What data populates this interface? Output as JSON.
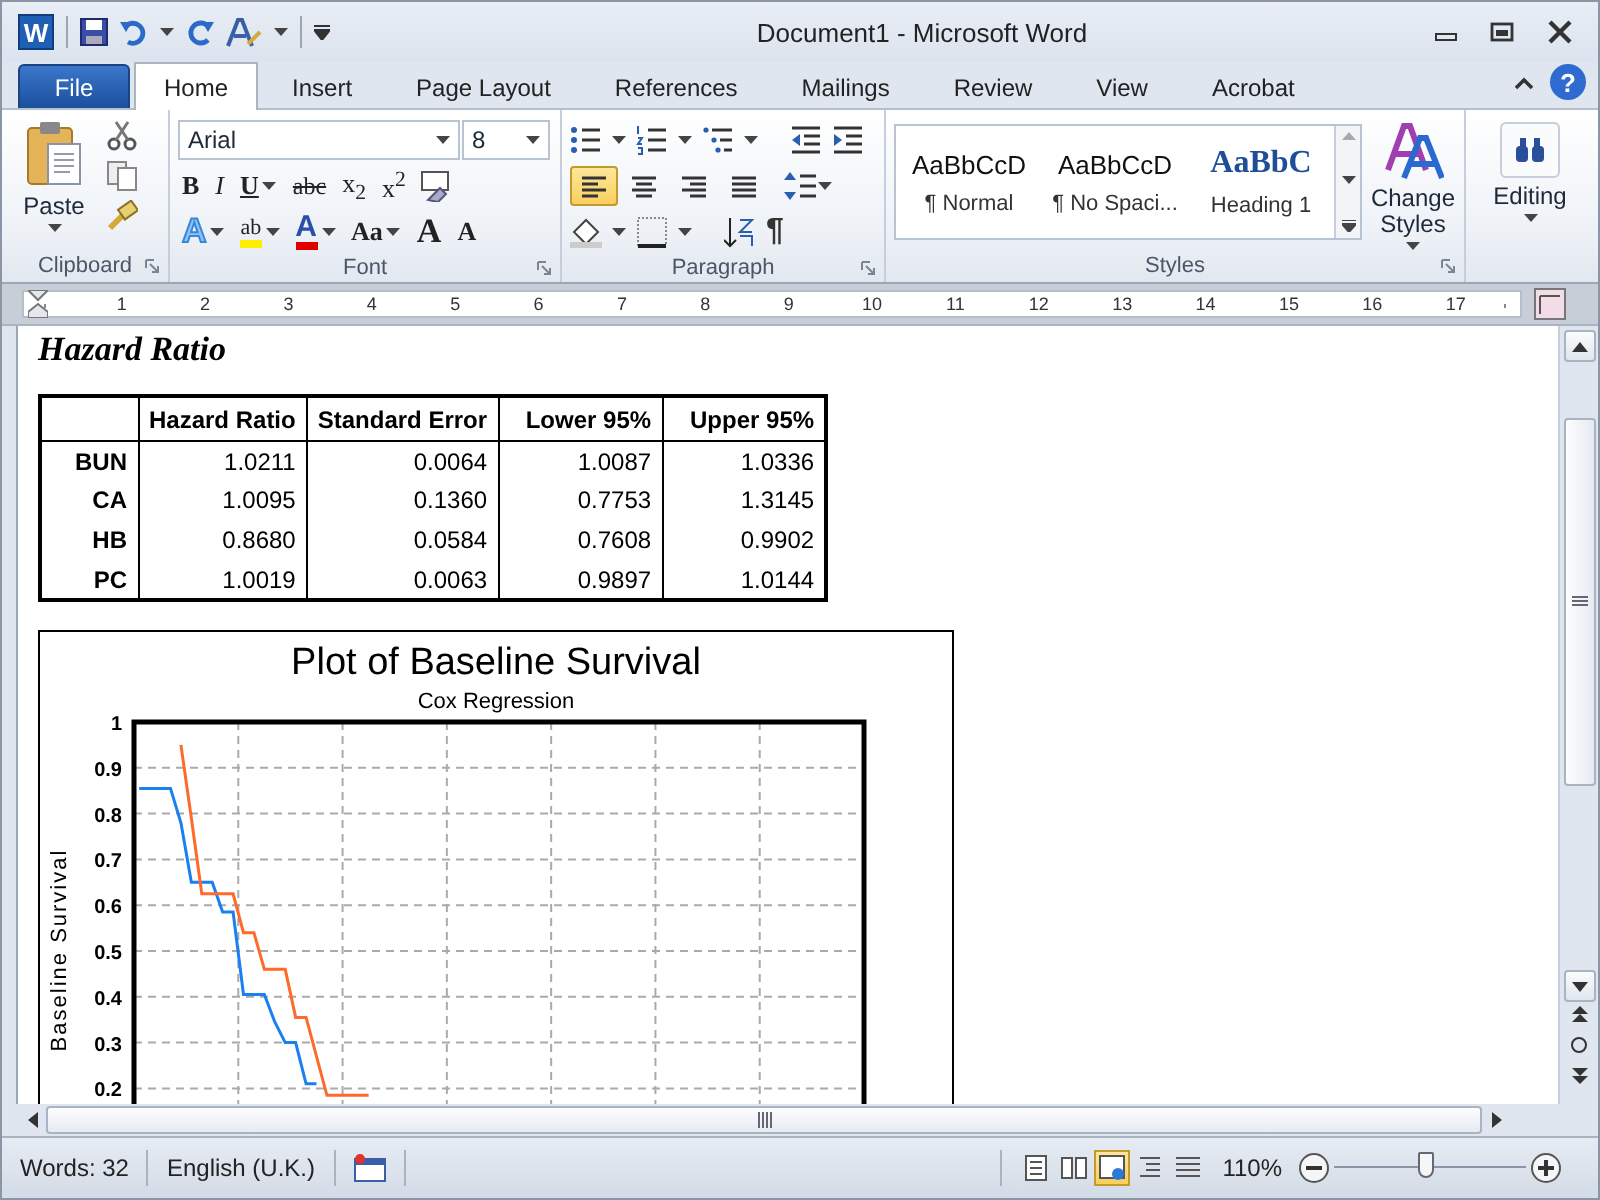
{
  "window": {
    "app_logo": "W",
    "title": "Document1 - Microsoft Word"
  },
  "tabs": [
    {
      "label": "File",
      "kind": "file",
      "selected": false
    },
    {
      "label": "Home",
      "kind": "tab",
      "selected": true
    },
    {
      "label": "Insert",
      "kind": "tab",
      "selected": false
    },
    {
      "label": "Page Layout",
      "kind": "tab",
      "selected": false
    },
    {
      "label": "References",
      "kind": "tab",
      "selected": false
    },
    {
      "label": "Mailings",
      "kind": "tab",
      "selected": false
    },
    {
      "label": "Review",
      "kind": "tab",
      "selected": false
    },
    {
      "label": "View",
      "kind": "tab",
      "selected": false
    },
    {
      "label": "Acrobat",
      "kind": "tab",
      "selected": false
    }
  ],
  "help": "?",
  "clipboard": {
    "paste": "Paste",
    "group_label": "Clipboard"
  },
  "font": {
    "name": "Arial",
    "size": "8",
    "group_label": "Font",
    "row_1": [
      {
        "text": "B",
        "kind": "bold"
      },
      {
        "text": "I",
        "kind": "italic"
      },
      {
        "text": "U",
        "kind": "underline"
      },
      {
        "text": "abc",
        "kind": "strike"
      },
      {
        "text": "x$_{2}$",
        "kind": "plain"
      },
      {
        "text": "x$^{2}$",
        "kind": "plain"
      }
    ],
    "row_2": [
      {
        "text": "A",
        "kind": "effects"
      },
      {
        "text": "ab",
        "kind": "highlight"
      },
      {
        "text": "A",
        "kind": "color"
      },
      {
        "text": "Aa",
        "kind": "case"
      },
      {
        "text": "A",
        "kind": "grow"
      },
      {
        "text": "A",
        "kind": "shrink"
      }
    ]
  },
  "paragraph": {
    "group_label": "Paragraph",
    "marks_glyph": "¶",
    "alignment": [
      {
        "selected": true
      },
      {
        "selected": false
      },
      {
        "selected": false
      },
      {
        "selected": false
      }
    ]
  },
  "styles": {
    "group_label": "Styles",
    "change_styles": "Change Styles",
    "gallery": [
      {
        "preview": "AaBbCcD",
        "name": "¶ Normal",
        "kind": "body"
      },
      {
        "preview": "AaBbCcD",
        "name": "¶ No Spaci...",
        "kind": "body"
      },
      {
        "preview": "AaBbC",
        "name": "Heading 1",
        "kind": "heading"
      }
    ]
  },
  "editing": {
    "label": "Editing"
  },
  "ruler": {
    "marks": [
      "1",
      "2",
      "3",
      "4",
      "5",
      "6",
      "7",
      "8",
      "9",
      "10",
      "11",
      "12",
      "13",
      "14",
      "15",
      "16",
      "17"
    ]
  },
  "document": {
    "heading": "Hazard Ratio",
    "table": {
      "columns": [
        "Hazard Ratio",
        "Standard Error",
        "Lower 95%",
        "Upper 95%"
      ],
      "rows": [
        {
          "label": "BUN",
          "values": [
            "1.0211",
            "0.0064",
            "1.0087",
            "1.0336"
          ]
        },
        {
          "label": "CA",
          "values": [
            "1.0095",
            "0.1360",
            "0.7753",
            "1.3145"
          ]
        },
        {
          "label": "HB",
          "values": [
            "0.8680",
            "0.0584",
            "0.7608",
            "0.9902"
          ]
        },
        {
          "label": "PC",
          "values": [
            "1.0019",
            "0.0063",
            "0.9897",
            "1.0144"
          ]
        }
      ]
    },
    "chart": {
      "subtitle": "Cox Regression",
      "chart_data": {
        "type": "line",
        "grid": true,
        "title": "Plot of Baseline Survival",
        "ylabel": "Baseline Survival",
        "ylim": [
          0,
          1
        ],
        "categories": [
          null,
          null,
          null,
          null,
          null,
          null,
          null,
          null,
          null,
          null,
          null,
          null,
          null,
          null,
          null,
          null,
          null,
          null,
          null,
          null,
          null,
          null,
          null,
          null,
          null,
          null,
          null,
          null,
          null,
          null,
          null,
          null,
          null,
          null,
          null,
          null,
          null,
          null,
          null,
          null,
          null,
          null,
          null,
          null,
          null,
          null,
          null,
          null,
          null,
          null,
          null,
          null,
          null,
          null,
          null,
          null,
          null,
          null,
          null,
          null,
          null,
          null,
          null,
          null,
          null,
          null,
          null,
          null,
          null,
          null
        ],
        "yticks": [
          {
            "value": 0.2,
            "label": "0.2"
          },
          {
            "value": 0.3,
            "label": "0.3"
          },
          {
            "value": 0.4,
            "label": "0.4"
          },
          {
            "value": 0.5,
            "label": "0.5"
          },
          {
            "value": 0.6,
            "label": "0.6"
          },
          {
            "value": 0.7,
            "label": "0.7"
          },
          {
            "value": 0.8,
            "label": "0.8"
          },
          {
            "value": 0.9,
            "label": "0.9"
          },
          {
            "value": 1,
            "label": "1"
          }
        ],
        "series": [
          {
            "color": "#1a7ff0",
            "values": [
              0.855,
              0.855,
              0.855,
              0.855,
              0.78,
              0.65,
              0.65,
              0.65,
              0.585,
              0.585,
              0.405,
              0.405,
              0.405,
              0.345,
              0.3,
              0.3,
              0.21,
              0.21,
              null,
              null,
              null,
              null,
              null,
              null,
              null,
              null,
              null,
              null,
              null,
              null,
              null,
              null,
              null,
              null,
              null,
              null,
              null,
              null,
              null,
              null,
              null,
              null,
              null,
              null,
              null,
              null,
              null,
              null,
              null,
              null,
              null,
              null,
              null,
              null,
              null,
              null,
              null,
              null,
              null,
              null,
              null,
              null,
              null,
              null,
              null,
              null,
              null,
              null,
              null,
              null
            ]
          },
          {
            "color": "#ff6a2a",
            "values": [
              null,
              null,
              null,
              null,
              0.95,
              0.79,
              0.625,
              0.625,
              0.625,
              0.625,
              0.54,
              0.54,
              0.46,
              0.46,
              0.46,
              0.355,
              0.355,
              0.27,
              0.185,
              0.185,
              0.185,
              0.185,
              0.185,
              null,
              null,
              null,
              null,
              null,
              null,
              null,
              null,
              null,
              null,
              null,
              null,
              null,
              null,
              null,
              null,
              null,
              null,
              null,
              null,
              null,
              null,
              null,
              null,
              null,
              null,
              null,
              null,
              null,
              null,
              null,
              null,
              null,
              null,
              null,
              null,
              null,
              null,
              null,
              null,
              null,
              null,
              null,
              null,
              null,
              null,
              null
            ]
          }
        ]
      }
    }
  },
  "status_bar": {
    "words": "Words: 32",
    "language": "English (U.K.)",
    "views": [
      {
        "selected": false
      },
      {
        "selected": false
      },
      {
        "selected": true
      },
      {
        "selected": false
      },
      {
        "selected": false
      }
    ],
    "zoom": "110%",
    "zoom_slider": {
      "level": 0.48
    }
  }
}
